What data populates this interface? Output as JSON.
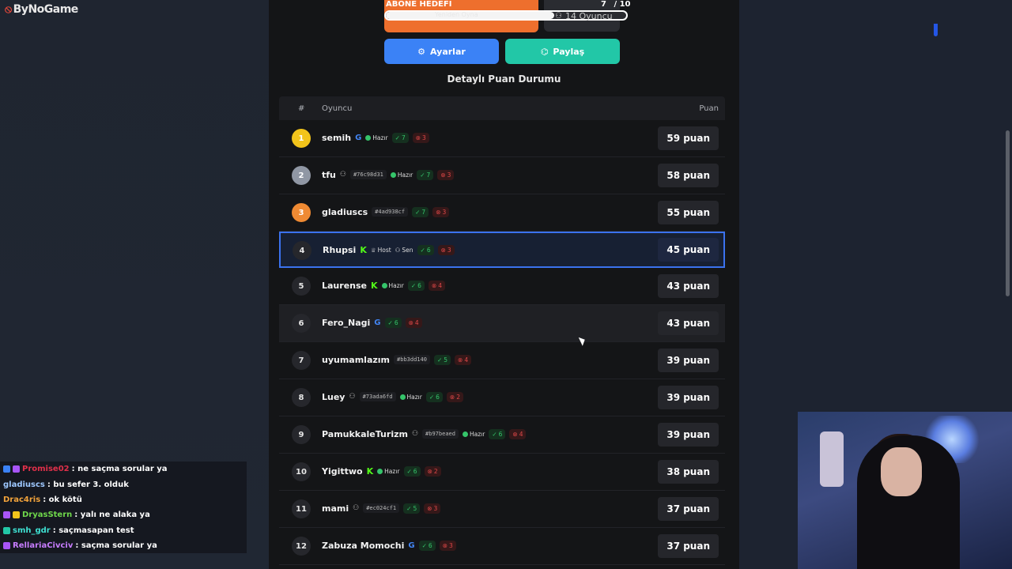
{
  "brand": "ByNoGame",
  "goal": {
    "label": "ABONE HEDEFİ",
    "current": "7",
    "target": "/ 10",
    "progress_percent": 70,
    "faded_text": "Yeniden Oyna",
    "players_text": "14 Oyuncu"
  },
  "buttons": {
    "settings": "Ayarlar",
    "share": "Paylaş"
  },
  "section_title": "Detaylı Puan Durumu",
  "table": {
    "headers": {
      "num": "#",
      "player": "Oyuncu",
      "score": "Puan"
    },
    "rows": [
      {
        "rank": "1",
        "name": "semih",
        "provider": "G",
        "tag": "",
        "ready": "Hazır",
        "host": "",
        "you": "",
        "wins": "7",
        "losses": "3",
        "score": "59 puan"
      },
      {
        "rank": "2",
        "name": "tfu",
        "provider": "guest",
        "tag": "#76c98d31",
        "ready": "Hazır",
        "host": "",
        "you": "",
        "wins": "7",
        "losses": "3",
        "score": "58 puan"
      },
      {
        "rank": "3",
        "name": "gladiuscs",
        "provider": "",
        "tag": "#4ad938cf",
        "ready": "",
        "host": "",
        "you": "",
        "wins": "7",
        "losses": "3",
        "score": "55 puan"
      },
      {
        "rank": "4",
        "name": "Rhupsi",
        "provider": "K",
        "tag": "",
        "ready": "",
        "host": "Host",
        "you": "Sen",
        "wins": "6",
        "losses": "3",
        "score": "45 puan"
      },
      {
        "rank": "5",
        "name": "Laurense",
        "provider": "K",
        "tag": "",
        "ready": "Hazır",
        "host": "",
        "you": "",
        "wins": "6",
        "losses": "4",
        "score": "43 puan"
      },
      {
        "rank": "6",
        "name": "Fero_Nagi",
        "provider": "G",
        "tag": "",
        "ready": "",
        "host": "",
        "you": "",
        "wins": "6",
        "losses": "4",
        "score": "43 puan"
      },
      {
        "rank": "7",
        "name": "uyumamlazım",
        "provider": "",
        "tag": "#bb3dd140",
        "ready": "",
        "host": "",
        "you": "",
        "wins": "5",
        "losses": "4",
        "score": "39 puan"
      },
      {
        "rank": "8",
        "name": "Luey",
        "provider": "guest",
        "tag": "#73ada6fd",
        "ready": "Hazır",
        "host": "",
        "you": "",
        "wins": "6",
        "losses": "2",
        "score": "39 puan"
      },
      {
        "rank": "9",
        "name": "PamukkaleTurizm",
        "provider": "guest",
        "tag": "#b97beaed",
        "ready": "Hazır",
        "host": "",
        "you": "",
        "wins": "6",
        "losses": "4",
        "score": "39 puan"
      },
      {
        "rank": "10",
        "name": "Yigittwo",
        "provider": "K",
        "tag": "",
        "ready": "Hazır",
        "host": "",
        "you": "",
        "wins": "6",
        "losses": "2",
        "score": "38 puan"
      },
      {
        "rank": "11",
        "name": "mami",
        "provider": "guest",
        "tag": "#ec024cf1",
        "ready": "",
        "host": "",
        "you": "",
        "wins": "5",
        "losses": "3",
        "score": "37 puan"
      },
      {
        "rank": "12",
        "name": "Zabuza Momochi",
        "provider": "G",
        "tag": "",
        "ready": "",
        "host": "",
        "you": "",
        "wins": "6",
        "losses": "3",
        "score": "37 puan"
      }
    ]
  },
  "chat": [
    {
      "user": "Promise02",
      "text": ": ne saçma sorular ya",
      "color": "#e0304a"
    },
    {
      "user": "gladiuscs",
      "text": ": bu sefer 3. olduk",
      "color": "#9ec8ff"
    },
    {
      "user": "Drac4ris",
      "text": ": ok kötü",
      "color": "#f2a33b"
    },
    {
      "user": "DryasStern",
      "text": ": yalı ne alaka ya",
      "color": "#6fd84b"
    },
    {
      "user": "smh_gdr",
      "text": ": saçmasapan test",
      "color": "#3ee0d2"
    },
    {
      "user": "RellariaCivciv",
      "text": ": saçma sorular ya",
      "color": "#c77dff"
    }
  ]
}
